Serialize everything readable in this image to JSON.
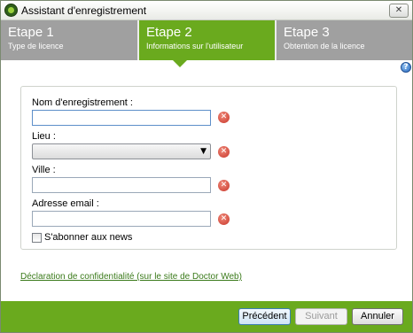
{
  "window": {
    "title": "Assistant d'enregistrement",
    "close_glyph": "✕"
  },
  "steps": [
    {
      "title": "Etape 1",
      "subtitle": "Type de licence",
      "state": "inactive"
    },
    {
      "title": "Etape 2",
      "subtitle": "Informations sur l'utilisateur",
      "state": "active"
    },
    {
      "title": "Etape 3",
      "subtitle": "Obtention de la licence",
      "state": "inactive"
    }
  ],
  "help": {
    "glyph": "?"
  },
  "form": {
    "fields": [
      {
        "label": "Nom d'enregistrement :",
        "value": "",
        "type": "text"
      },
      {
        "label": "Lieu :",
        "value": "",
        "type": "select"
      },
      {
        "label": "Ville :",
        "value": "",
        "type": "text"
      },
      {
        "label": "Adresse email :",
        "value": "",
        "type": "text"
      }
    ],
    "error_glyph": "✕",
    "select_arrow": "▼",
    "subscribe": {
      "label": "S'abonner aux news",
      "checked": false
    }
  },
  "privacy_link": "Déclaration de confidentialité (sur le site de Doctor Web)",
  "footer": {
    "previous": "Précédent",
    "next": "Suivant",
    "cancel": "Annuler"
  },
  "colors": {
    "accent_green": "#6aaa1e",
    "inactive_step": "#a0a0a0",
    "error_red": "#c8362a",
    "link_green": "#3a7a1a"
  },
  "icons": {
    "app": "drweb-spider-icon",
    "close": "close-icon",
    "help": "help-icon",
    "error": "error-icon",
    "dropdown": "chevron-down-icon"
  }
}
